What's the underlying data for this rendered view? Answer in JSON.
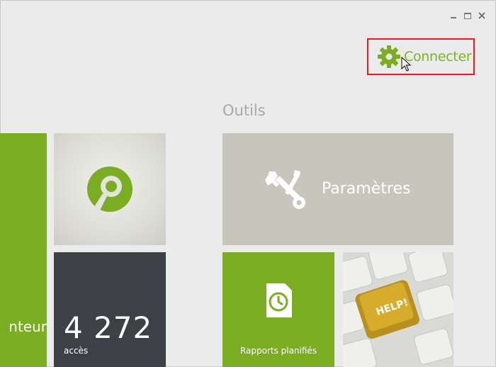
{
  "window": {
    "controls": [
      "minimize",
      "maximize",
      "close"
    ]
  },
  "connect": {
    "label": "Connecter",
    "icon": "gear-icon",
    "highlight_color": "#e81c1c",
    "accent": "#7db226"
  },
  "sections": {
    "tools_title": "Outils"
  },
  "tiles": {
    "left_green": {
      "label": "nteur"
    },
    "logo": {
      "icon": "p-logo-icon"
    },
    "stats": {
      "number": "4 272",
      "caption": "accès"
    },
    "params": {
      "label": "Paramètres",
      "icon": "tools-icon"
    },
    "reports": {
      "label": "Rapports planifiés",
      "icon": "scheduled-report-icon"
    },
    "help": {
      "key_text": "HELP!",
      "icon": "help-key-image"
    }
  }
}
